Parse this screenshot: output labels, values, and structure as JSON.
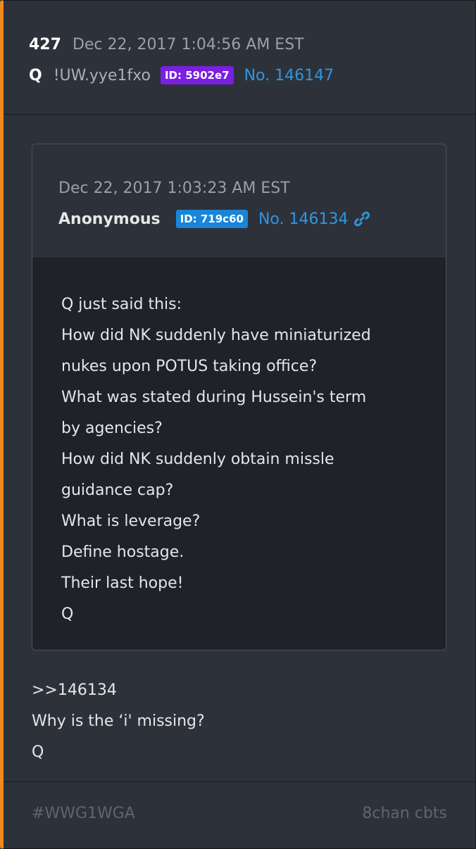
{
  "post": {
    "number": "427",
    "timestamp": "Dec 22, 2017 1:04:56 AM EST",
    "author": "Q",
    "tripcode": "!UW.yye1fxo",
    "id_badge": "ID: 5902e7",
    "post_link": "No. 146147",
    "reply_lines": [
      ">>146134",
      "Why is the ‘i' missing?",
      "Q"
    ]
  },
  "quoted_post": {
    "timestamp": "Dec 22, 2017 1:03:23 AM EST",
    "author": "Anonymous",
    "id_badge": "ID: 719c60",
    "post_link": "No. 146134",
    "link_icon": "link-icon",
    "body_lines": [
      "Q just said this:",
      "How did NK suddenly have miniaturized",
      "nukes upon POTUS taking office?",
      "What was stated during Hussein's term",
      "by agencies?",
      "How did NK suddenly obtain missle",
      "guidance cap?",
      "What is leverage?",
      "Define hostage.",
      "Their last hope!",
      "Q"
    ]
  },
  "footer": {
    "hashtag": "#WWG1WGA",
    "board": "8chan cbts"
  },
  "colors": {
    "accent_stripe": "#f08a1c",
    "id_badge_q": "#7b1fe0",
    "id_badge_anon": "#1a85d8",
    "link": "#2f96e0"
  }
}
